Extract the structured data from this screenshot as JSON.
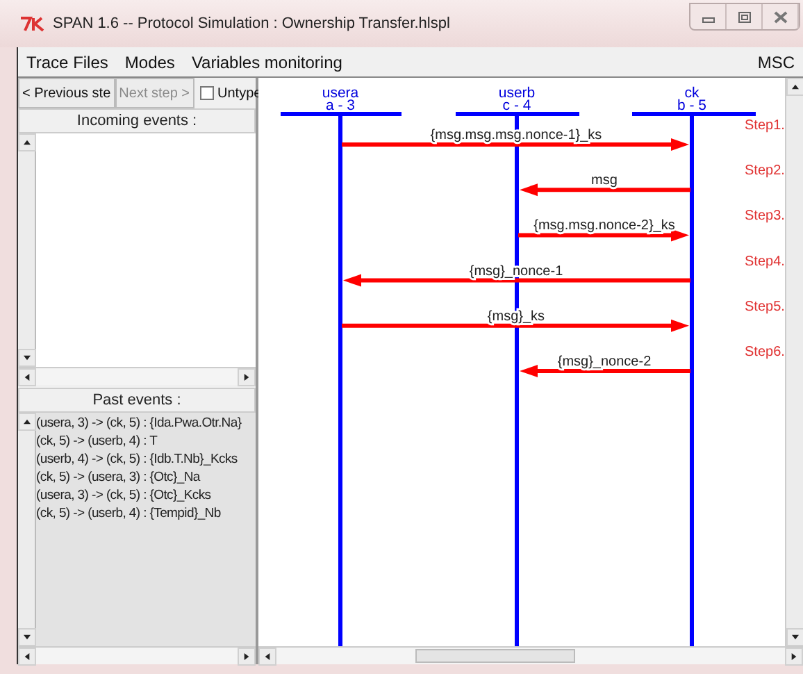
{
  "window": {
    "title": "SPAN 1.6 -- Protocol Simulation : Ownership Transfer.hlspl"
  },
  "menu": [
    "Trace Files",
    "Modes",
    "Variables monitoring"
  ],
  "menu_right": "MSC",
  "controls": [
    {
      "kind": "button",
      "label": "< Previous ste",
      "disabled": false
    },
    {
      "kind": "button",
      "label": "Next step >",
      "disabled": true
    },
    {
      "kind": "checkbox",
      "label": "Untype",
      "checked": false
    }
  ],
  "incoming_events": {
    "title": "Incoming events :"
  },
  "past_events": {
    "title": "Past events :",
    "items": [
      "(usera, 3) -> (ck, 5) : {Ida.Pwa.Otr.Na}",
      "(ck, 5) -> (userb, 4) : T",
      "(userb, 4) -> (ck, 5) : {Idb.T.Nb}_Kcks",
      "(ck, 5) -> (usera, 3) : {Otc}_Na",
      "(usera, 3) -> (ck, 5) : {Otc}_Kcks",
      "(ck, 5) -> (userb, 4) : {Tempid}_Nb"
    ]
  },
  "diagram": {
    "participants": [
      {
        "name": "usera",
        "label": "a - 3"
      },
      {
        "name": "userb",
        "label": "c - 4"
      },
      {
        "name": "ck",
        "label": "b - 5"
      }
    ],
    "messages": [
      {
        "label": "{msg.msg.msg.nonce-1}_ks",
        "step": "Step1.",
        "kind": "long-rightward"
      },
      {
        "label": "msg",
        "step": "Step2.",
        "kind": "short-leftward"
      },
      {
        "label": "{msg.msg.nonce-2}_ks",
        "step": "Step3.",
        "kind": "short-rightward"
      },
      {
        "label": "{msg}_nonce-1",
        "step": "Step4.",
        "kind": "long-leftward"
      },
      {
        "label": "{msg}_ks",
        "step": "Step5.",
        "kind": "long-rightward"
      },
      {
        "label": "{msg}_nonce-2",
        "step": "Step6.",
        "kind": "short-leftward"
      }
    ]
  }
}
